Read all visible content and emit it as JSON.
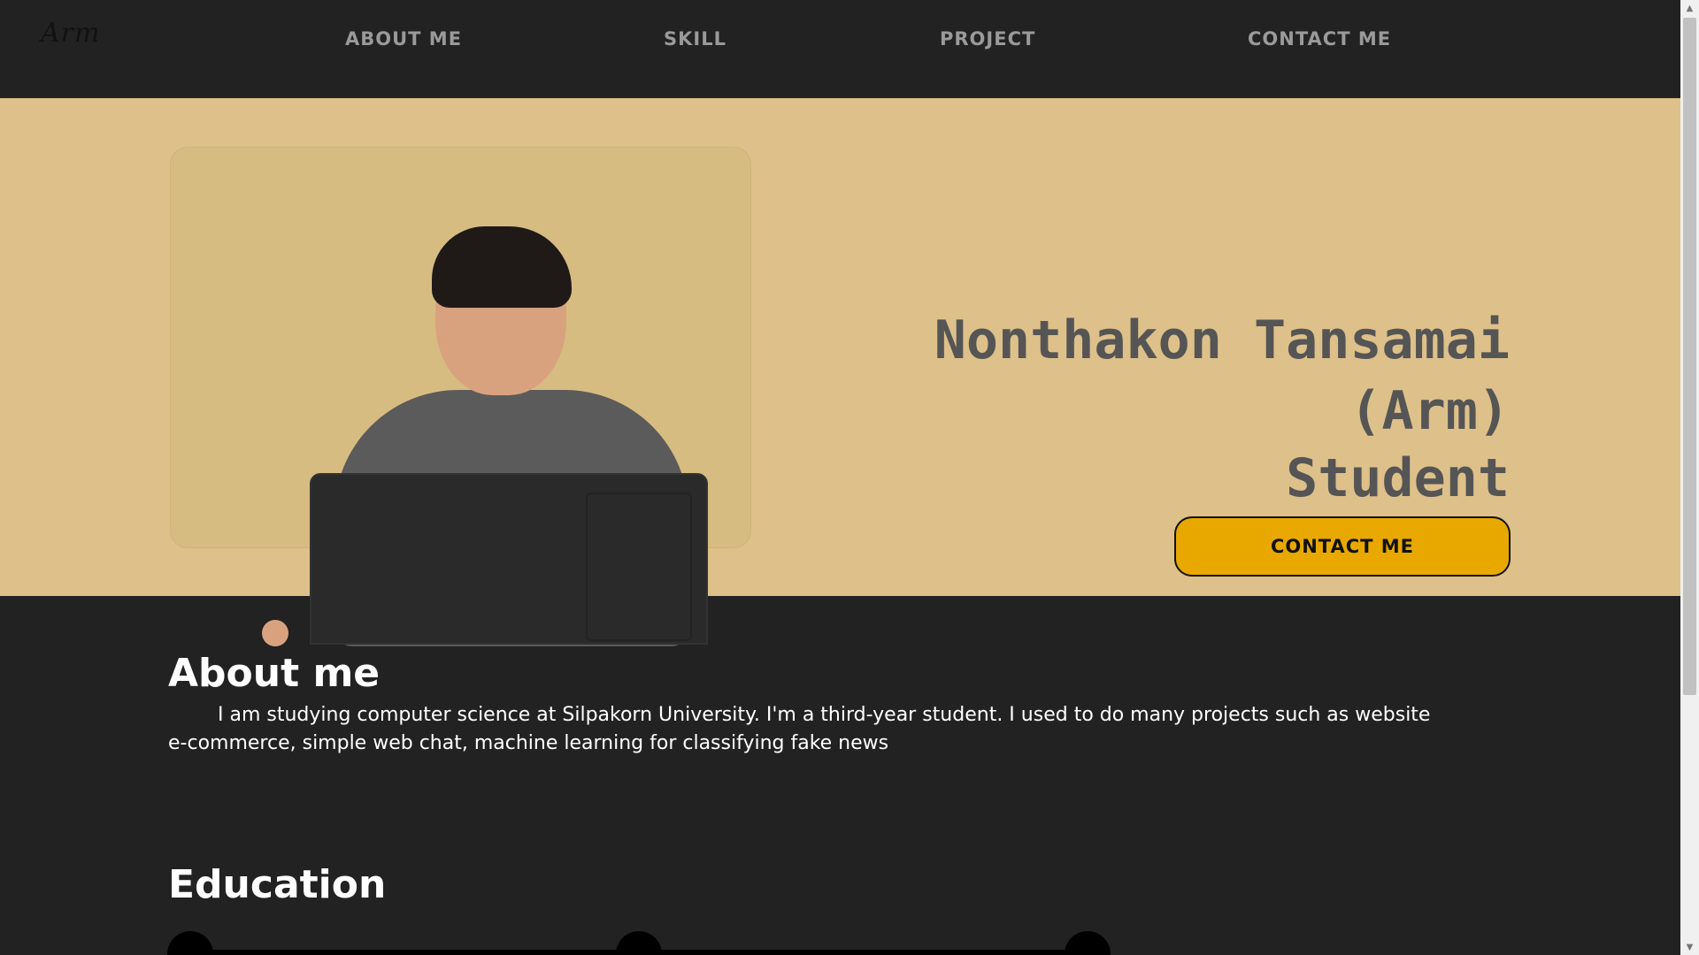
{
  "navbar": {
    "logo": "Arm",
    "links": [
      "ABOUT ME",
      "SKILL",
      "PROJECT",
      "CONTACT ME"
    ]
  },
  "hero": {
    "name_line1": "Nonthakon Tansamai",
    "name_line2": "(Arm)",
    "role": "Student",
    "contact_button": "CONTACT ME"
  },
  "about": {
    "title": "About me",
    "text": "I am studying computer science at Silpakorn University. I'm a third-year student. I used to do many projects such as website e-commerce, simple web chat, machine learning for classifying fake news"
  },
  "education": {
    "title": "Education"
  },
  "colors": {
    "background_dark": "#222222",
    "hero_background": "#dec08a",
    "accent_button": "#e8a800",
    "heading_text": "#555555",
    "nav_text": "#9a9a9a"
  },
  "icons": {
    "scroll_up": "triangle-up-icon",
    "scroll_down": "triangle-down-icon"
  }
}
